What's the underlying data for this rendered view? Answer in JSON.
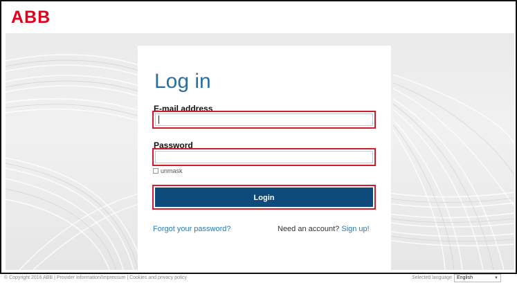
{
  "brand": {
    "logo_text": "ABB",
    "logo_color": "#e2001a"
  },
  "login": {
    "title": "Log in",
    "email_label": "E-mail address",
    "email_value": "",
    "password_label": "Password",
    "password_value": "",
    "unmask_label": "unmask",
    "unmask_checked": false,
    "submit_label": "Login",
    "forgot_link": "Forgot your password?",
    "need_account_text": "Need an account?",
    "signup_link": "Sign up!"
  },
  "footer": {
    "copyright": "© Copyright 2016 ABB | Provider Information/Impressum | Cookies and privacy policy",
    "language_label": "Selected language",
    "language_value": "English"
  },
  "colors": {
    "accent": "#2a6f9e",
    "button": "#0f4b7a",
    "highlight": "#d11a2a",
    "link": "#2a7ab8"
  }
}
